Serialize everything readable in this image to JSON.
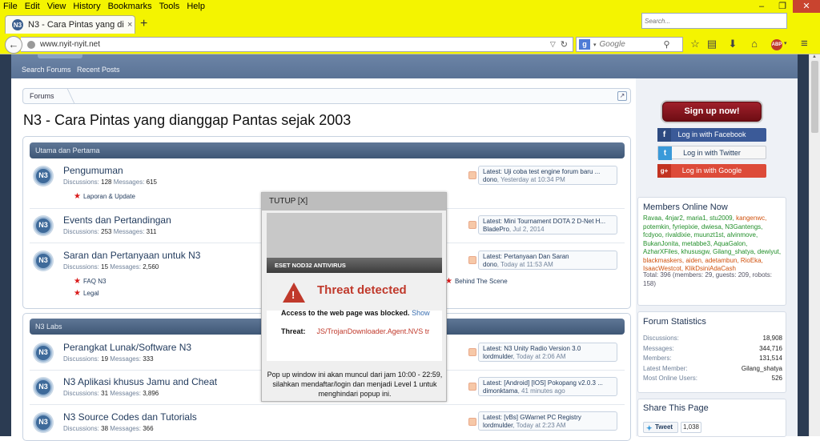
{
  "menu": [
    "File",
    "Edit",
    "View",
    "History",
    "Bookmarks",
    "Tools",
    "Help"
  ],
  "tab": {
    "title": "N3 - Cara Pintas yang diangga...",
    "close": "×",
    "new": "+"
  },
  "url": "www.nyit-nyit.net",
  "search_placeholder": "Google",
  "window_controls": [
    "–",
    "❐",
    "✕"
  ],
  "forum_nav": {
    "partial": "Forums",
    "search": "Search Forums",
    "recent": "Recent Posts"
  },
  "sidebar_search_placeholder": "Search...",
  "breadcrumb": "Forums",
  "page_title": "N3 - Cara Pintas yang dianggap Pantas sejak 2003",
  "categories": [
    {
      "title": "Utama dan Pertama"
    },
    {
      "title": "N3 Labs"
    }
  ],
  "nodes": [
    {
      "title": "Pengumuman",
      "disc_label": "Discussions:",
      "disc": "128",
      "msg_label": "Messages:",
      "msg": "615",
      "latest_title": "Latest: Uji coba test engine forum baru ...",
      "latest_user": "dono",
      "latest_time": "Yesterday at 10:34 PM"
    },
    {
      "title": "Events dan Pertandingan",
      "disc_label": "Discussions:",
      "disc": "253",
      "msg_label": "Messages:",
      "msg": "311",
      "latest_title": "Latest: Mini Tournament DOTA 2 D-Net H...",
      "latest_user": "BladePro",
      "latest_time": "Jul 2, 2014"
    },
    {
      "title": "Saran dan Pertanyaan untuk N3",
      "disc_label": "Discussions:",
      "disc": "15",
      "msg_label": "Messages:",
      "msg": "2,560",
      "latest_title": "Latest: Pertanyaan Dan Saran",
      "latest_user": "dono",
      "latest_time": "Today at 11:53 AM"
    },
    {
      "title": "Perangkat Lunak/Software N3",
      "disc_label": "Discussions:",
      "disc": "19",
      "msg_label": "Messages:",
      "msg": "333",
      "latest_title": "Latest: N3 Unity Radio Version 3.0",
      "latest_user": "lordmulder",
      "latest_time": "Today at 2:06 AM"
    },
    {
      "title": "N3 Aplikasi khusus Jamu and Cheat",
      "disc_label": "Discussions:",
      "disc": "31",
      "msg_label": "Messages:",
      "msg": "3,896",
      "latest_title": "Latest: [Android] [IOS] Pokopang v2.0.3 ...",
      "latest_user": "dimonktama",
      "latest_time": "41 minutes ago"
    },
    {
      "title": "N3 Source Codes dan Tutorials",
      "disc_label": "Discussions:",
      "disc": "38",
      "msg_label": "Messages:",
      "msg": "366",
      "latest_title": "Latest: [vBs] GWarnet PC Registry",
      "latest_user": "lordmulder",
      "latest_time": "Today at 2:23 AM"
    }
  ],
  "subforums": {
    "laporan": "Laporan & Update",
    "faq": "FAQ N3",
    "legal": "Legal",
    "behind": "Behind The Scene"
  },
  "signup": "Sign up now!",
  "social": {
    "facebook": "Log in with Facebook",
    "twitter": "Log in with Twitter",
    "google": "Log in with Google"
  },
  "members_online": {
    "title": "Members Online Now",
    "list_a": "Ravaa, 4njar2, maria1, stu2009,",
    "list_a2": "kangenwc,",
    "list_b": "potemkin, fyriepixie, dwiesa, N3Gantengs, fcdyoo, rivaldixie, muunzt1st, alvinmove, BukanJonita, metabbe3, AquaGalon, AzharXFiles, khususgw, Gilang_shatya, dewiyut,",
    "list_c": "blackmaskers, aiden, adetambun, RioEka, IsaacWestcot, KlikDsiniAdaCash",
    "total": "Total: 396 (members: 29, guests: 209, robots: 158)"
  },
  "forum_stats": {
    "title": "Forum Statistics",
    "rows": [
      {
        "label": "Discussions:",
        "value": "18,908"
      },
      {
        "label": "Messages:",
        "value": "344,716"
      },
      {
        "label": "Members:",
        "value": "131,514"
      },
      {
        "label": "Latest Member:",
        "value": "Gilang_shatya"
      },
      {
        "label": "Most Online Users:",
        "value": "526"
      }
    ]
  },
  "share": {
    "title": "Share This Page",
    "tweet": "Tweet",
    "count": "1,038"
  },
  "popup": {
    "header": "TUTUP [X]",
    "eset": "ESET NOD32 ANTIVIRUS",
    "threat": "Threat detected",
    "message": "Access to the web page was blocked.",
    "show": "Show",
    "threat_label": "Threat:",
    "threat_name": "JS/TrojanDownloader.Agent.NVS tr",
    "footer": "Pop up window ini akan muncul dari jam 10:00 - 22:59, silahkan mendaftar/login dan menjadi Level 1 untuk menghindari popup ini."
  }
}
